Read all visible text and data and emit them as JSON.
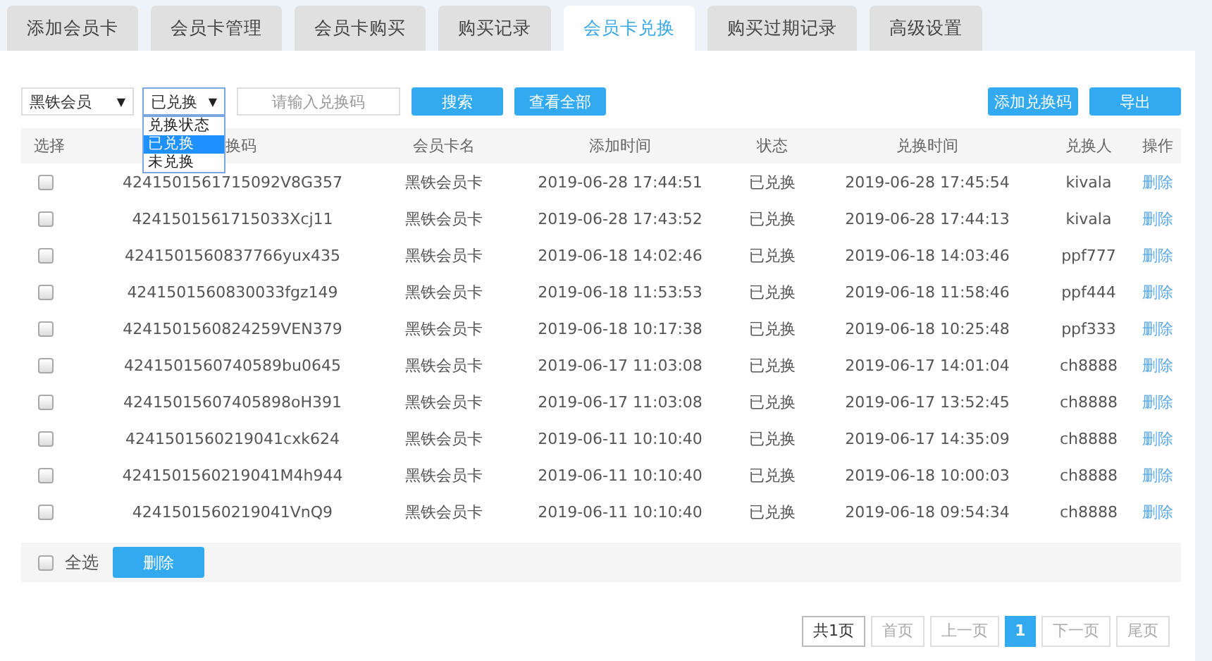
{
  "tabs": [
    {
      "label": "添加会员卡",
      "selected": false
    },
    {
      "label": "会员卡管理",
      "selected": false
    },
    {
      "label": "会员卡购买",
      "selected": false
    },
    {
      "label": "购买记录",
      "selected": false
    },
    {
      "label": "会员卡兑换",
      "selected": true
    },
    {
      "label": "购买过期记录",
      "selected": false
    },
    {
      "label": "高级设置",
      "selected": false
    }
  ],
  "filters": {
    "card_type_select": {
      "value": "黑铁会员",
      "caret": "▼"
    },
    "status_select": {
      "value": "已兑换",
      "caret": "▼",
      "expanded": true,
      "options": [
        {
          "label": "兑换状态",
          "selected": false
        },
        {
          "label": "已兑换",
          "selected": true
        },
        {
          "label": "未兑换",
          "selected": false
        }
      ]
    },
    "code_input": {
      "placeholder": "请输入兑换码"
    },
    "search_button": "搜索",
    "view_all_button": "查看全部",
    "add_code_button": "添加兑换码",
    "export_button": "导出"
  },
  "table": {
    "columns": [
      "选择",
      "换码",
      "会员卡名",
      "添加时间",
      "状态",
      "兑换时间",
      "兑换人",
      "操作"
    ],
    "rows": [
      {
        "checked": false,
        "code": "4241501561715092V8G357",
        "card_name": "黑铁会员卡",
        "added": "2019-06-28 17:44:51",
        "status": "已兑换",
        "exchanged": "2019-06-28 17:45:54",
        "user": "kivala",
        "action": "删除"
      },
      {
        "checked": false,
        "code": "4241501561715033Xcj11",
        "card_name": "黑铁会员卡",
        "added": "2019-06-28 17:43:52",
        "status": "已兑换",
        "exchanged": "2019-06-28 17:44:13",
        "user": "kivala",
        "action": "删除"
      },
      {
        "checked": false,
        "code": "4241501560837766yux435",
        "card_name": "黑铁会员卡",
        "added": "2019-06-18 14:02:46",
        "status": "已兑换",
        "exchanged": "2019-06-18 14:03:46",
        "user": "ppf777",
        "action": "删除"
      },
      {
        "checked": false,
        "code": "4241501560830033fgz149",
        "card_name": "黑铁会员卡",
        "added": "2019-06-18 11:53:53",
        "status": "已兑换",
        "exchanged": "2019-06-18 11:58:46",
        "user": "ppf444",
        "action": "删除"
      },
      {
        "checked": false,
        "code": "4241501560824259VEN379",
        "card_name": "黑铁会员卡",
        "added": "2019-06-18 10:17:38",
        "status": "已兑换",
        "exchanged": "2019-06-18 10:25:48",
        "user": "ppf333",
        "action": "删除"
      },
      {
        "checked": false,
        "code": "4241501560740589bu0645",
        "card_name": "黑铁会员卡",
        "added": "2019-06-17 11:03:08",
        "status": "已兑换",
        "exchanged": "2019-06-17 14:01:04",
        "user": "ch8888",
        "action": "删除"
      },
      {
        "checked": false,
        "code": "42415015607405898oH391",
        "card_name": "黑铁会员卡",
        "added": "2019-06-17 11:03:08",
        "status": "已兑换",
        "exchanged": "2019-06-17 13:52:45",
        "user": "ch8888",
        "action": "删除"
      },
      {
        "checked": false,
        "code": "4241501560219041cxk624",
        "card_name": "黑铁会员卡",
        "added": "2019-06-11 10:10:40",
        "status": "已兑换",
        "exchanged": "2019-06-17 14:35:09",
        "user": "ch8888",
        "action": "删除"
      },
      {
        "checked": false,
        "code": "4241501560219041M4h944",
        "card_name": "黑铁会员卡",
        "added": "2019-06-11 10:10:40",
        "status": "已兑换",
        "exchanged": "2019-06-18 10:00:03",
        "user": "ch8888",
        "action": "删除"
      },
      {
        "checked": false,
        "code": "4241501560219041VnQ9",
        "card_name": "黑铁会员卡",
        "added": "2019-06-11 10:10:40",
        "status": "已兑换",
        "exchanged": "2019-06-18 09:54:34",
        "user": "ch8888",
        "action": "删除"
      }
    ]
  },
  "footer": {
    "select_all": {
      "label": "全选",
      "checked": false
    },
    "delete_button": "删除"
  },
  "pagination": {
    "total": "共1页",
    "first": {
      "label": "首页",
      "disabled": true
    },
    "prev": {
      "label": "上一页",
      "disabled": true
    },
    "pages": [
      {
        "label": "1",
        "selected": true
      }
    ],
    "next": {
      "label": "下一页",
      "disabled": true
    },
    "last": {
      "label": "尾页",
      "disabled": true
    }
  }
}
